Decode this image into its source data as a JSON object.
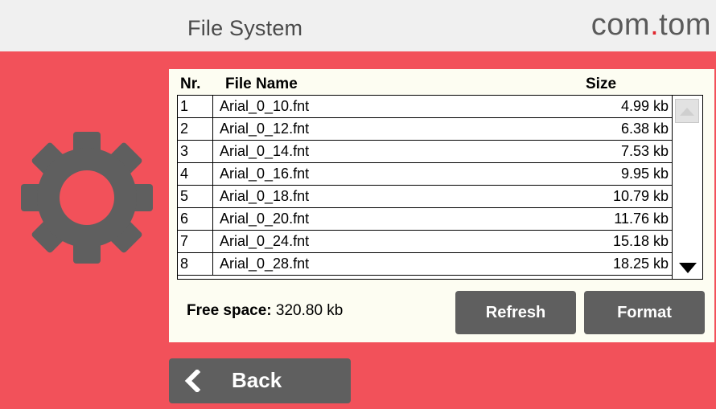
{
  "header": {
    "title": "File System",
    "logo_prefix": "com",
    "logo_dot": ".",
    "logo_suffix": "tom"
  },
  "colors": {
    "accent": "#f2515a",
    "button": "#5f5f5f",
    "header_bg": "#f0f0f0",
    "panel_bg": "#fdfdf2"
  },
  "icons": {
    "settings": "gear-icon",
    "back": "chevron-left-icon",
    "scroll_up": "triangle-up-icon",
    "scroll_down": "triangle-down-icon"
  },
  "table": {
    "columns": [
      "Nr.",
      "File Name",
      "Size"
    ],
    "rows": [
      {
        "nr": "1",
        "name": "Arial_0_10.fnt",
        "size": "4.99 kb"
      },
      {
        "nr": "2",
        "name": "Arial_0_12.fnt",
        "size": "6.38 kb"
      },
      {
        "nr": "3",
        "name": "Arial_0_14.fnt",
        "size": "7.53 kb"
      },
      {
        "nr": "4",
        "name": "Arial_0_16.fnt",
        "size": "9.95 kb"
      },
      {
        "nr": "5",
        "name": "Arial_0_18.fnt",
        "size": "10.79 kb"
      },
      {
        "nr": "6",
        "name": "Arial_0_20.fnt",
        "size": "11.76 kb"
      },
      {
        "nr": "7",
        "name": "Arial_0_24.fnt",
        "size": "15.18 kb"
      },
      {
        "nr": "8",
        "name": "Arial_0_28.fnt",
        "size": "18.25 kb"
      }
    ]
  },
  "free_space": {
    "label": "Free space:",
    "value": "320.80 kb"
  },
  "buttons": {
    "refresh": "Refresh",
    "format": "Format",
    "back": "Back"
  }
}
